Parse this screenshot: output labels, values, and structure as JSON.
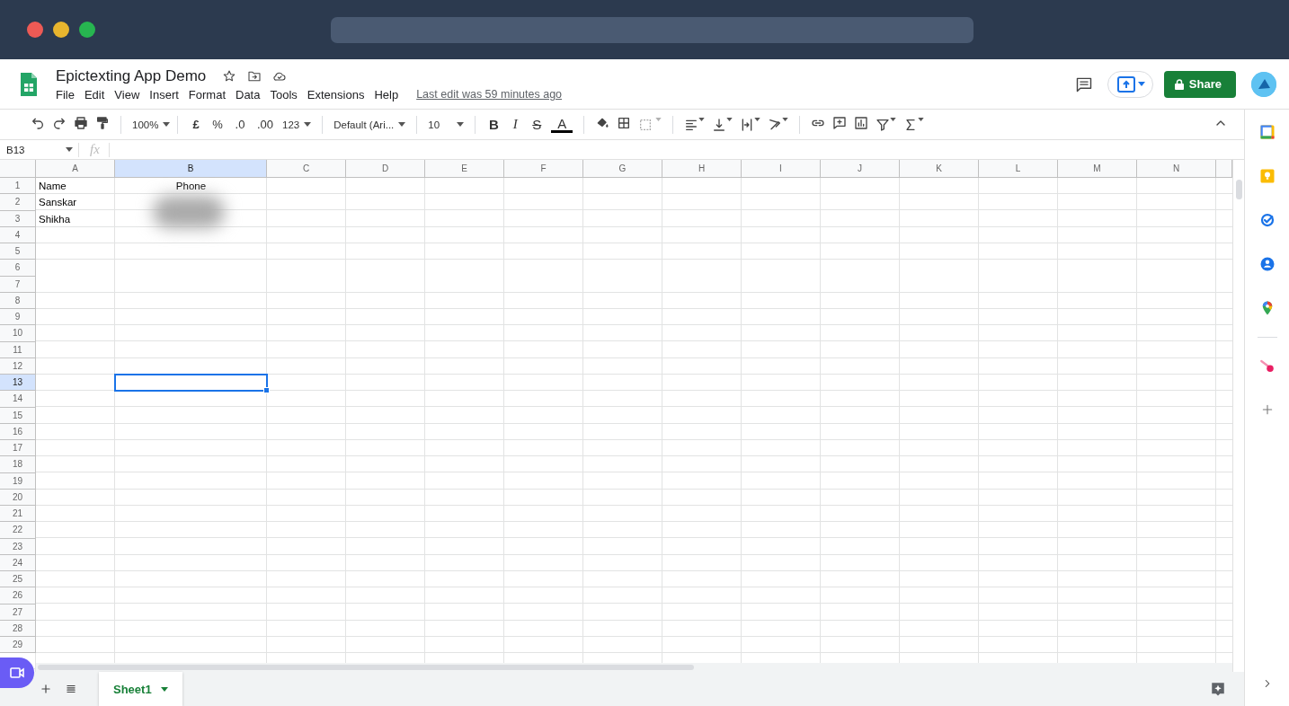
{
  "document": {
    "title": "Epictexting App Demo",
    "last_edit": "Last edit was 59 minutes ago"
  },
  "menu": [
    "File",
    "Edit",
    "View",
    "Insert",
    "Format",
    "Data",
    "Tools",
    "Extensions",
    "Help"
  ],
  "share_button": "Share",
  "toolbar": {
    "zoom": "100%",
    "currency": "£",
    "percent": "%",
    "decimal_decrease": ".0",
    "decimal_increase": ".00",
    "number_format": "123",
    "font": "Default (Ari...",
    "font_size": "10",
    "bold": "B",
    "italic": "I",
    "strikethrough": "S",
    "text_color": "A"
  },
  "name_box": "B13",
  "formula_label": "fx",
  "grid": {
    "columns": [
      {
        "label": "A",
        "selected": false
      },
      {
        "label": "B",
        "selected": true
      },
      {
        "label": "C",
        "selected": false
      },
      {
        "label": "D",
        "selected": false
      },
      {
        "label": "E",
        "selected": false
      },
      {
        "label": "F",
        "selected": false
      },
      {
        "label": "G",
        "selected": false
      },
      {
        "label": "H",
        "selected": false
      },
      {
        "label": "I",
        "selected": false
      },
      {
        "label": "J",
        "selected": false
      },
      {
        "label": "K",
        "selected": false
      },
      {
        "label": "L",
        "selected": false
      },
      {
        "label": "M",
        "selected": false
      },
      {
        "label": "N",
        "selected": false
      }
    ],
    "rows": [
      {
        "label": "1",
        "selected": false,
        "cells": [
          {
            "kind": "text",
            "text": "Name"
          },
          {
            "kind": "text",
            "text": "Phone",
            "centered": true
          }
        ]
      },
      {
        "label": "2",
        "selected": false,
        "cells": [
          {
            "kind": "text",
            "text": "Sanskar"
          },
          {
            "kind": "redacted"
          }
        ]
      },
      {
        "label": "3",
        "selected": false,
        "cells": [
          {
            "kind": "text",
            "text": "Shikha"
          },
          {
            "kind": "redacted"
          }
        ]
      },
      {
        "label": "4",
        "selected": false
      },
      {
        "label": "5",
        "selected": false
      },
      {
        "label": "6",
        "selected": false
      },
      {
        "label": "7",
        "selected": false
      },
      {
        "label": "8",
        "selected": false
      },
      {
        "label": "9",
        "selected": false
      },
      {
        "label": "10",
        "selected": false
      },
      {
        "label": "11",
        "selected": false
      },
      {
        "label": "12",
        "selected": false
      },
      {
        "label": "13",
        "selected": true
      },
      {
        "label": "14",
        "selected": false
      },
      {
        "label": "15",
        "selected": false
      },
      {
        "label": "16",
        "selected": false
      },
      {
        "label": "17",
        "selected": false
      },
      {
        "label": "18",
        "selected": false
      },
      {
        "label": "19",
        "selected": false
      },
      {
        "label": "20",
        "selected": false
      },
      {
        "label": "21",
        "selected": false
      },
      {
        "label": "22",
        "selected": false
      },
      {
        "label": "23",
        "selected": false
      },
      {
        "label": "24",
        "selected": false
      },
      {
        "label": "25",
        "selected": false
      },
      {
        "label": "26",
        "selected": false
      },
      {
        "label": "27",
        "selected": false
      },
      {
        "label": "28",
        "selected": false
      },
      {
        "label": "29",
        "selected": false
      }
    ]
  },
  "sheet_tabs": [
    {
      "label": "Sheet1",
      "selected": true
    }
  ]
}
